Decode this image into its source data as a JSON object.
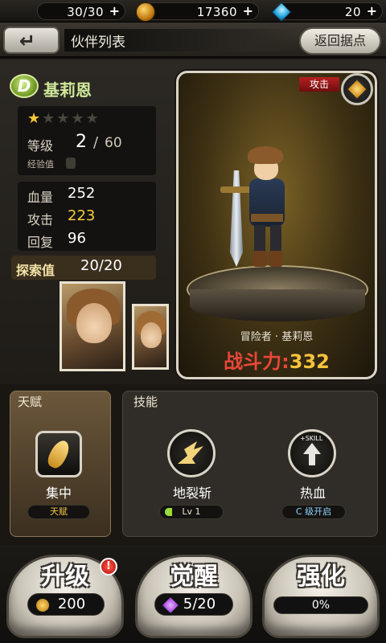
{
  "resources": {
    "stamina": "30/30",
    "coins": "17360",
    "gems": "20",
    "plus": "+"
  },
  "header": {
    "back_icon": "arrow-left-icon",
    "title": "伙伴列表",
    "home_button": "返回据点"
  },
  "hero": {
    "rank": "D",
    "name": "基莉恩",
    "stars_filled": 1,
    "stars_total": 5,
    "level_label": "等级",
    "level": "2",
    "level_separator": "/",
    "level_max": "60",
    "exp_label": "经验值",
    "hp_label": "血量",
    "hp": "252",
    "atk_label": "攻击",
    "atk": "223",
    "rec_label": "回复",
    "rec": "96",
    "explore_label": "探索值",
    "explore_value": "20/20"
  },
  "card": {
    "type_tag": "攻击",
    "element_icon": "element-hex-icon",
    "title": "冒险者 · 基莉恩",
    "power_label": "战斗力:",
    "power_value": "332"
  },
  "talent": {
    "section_title": "天赋",
    "icon": "feather-icon",
    "name": "集中",
    "tag": "天赋"
  },
  "skills": {
    "section_title": "技能",
    "items": [
      {
        "icon": "ground-slash-icon",
        "name": "地裂斩",
        "status": "Lv 1"
      },
      {
        "icon": "skill-arrow-icon",
        "badge": "+SKILL",
        "name": "热血",
        "status": "C 级开启"
      }
    ]
  },
  "actions": {
    "levelup": {
      "label": "升级",
      "cost": "200",
      "alert": "!"
    },
    "awaken": {
      "label": "觉醒",
      "cost": "5/20"
    },
    "enhance": {
      "label": "强化",
      "progress_text": "0%",
      "progress": 0
    }
  },
  "colors": {
    "accent_gold": "#f4cf3b",
    "power_red": "#e8473a",
    "name_green": "#cfe99a"
  }
}
